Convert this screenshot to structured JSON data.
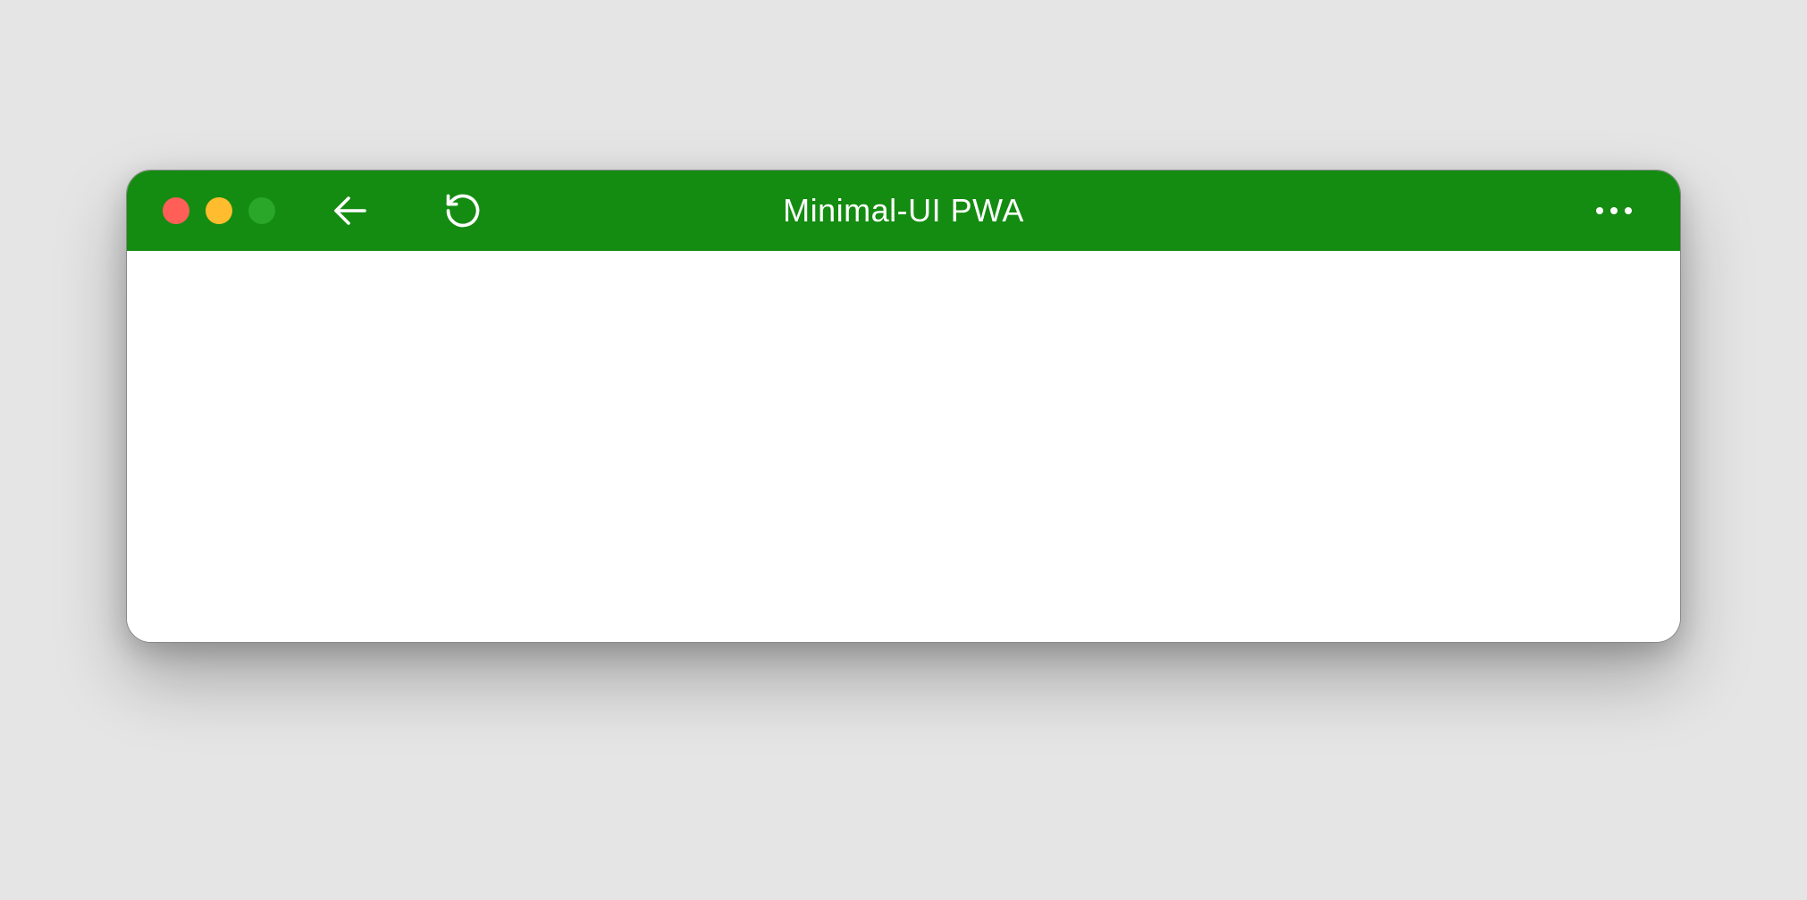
{
  "window": {
    "title": "Minimal-UI PWA"
  },
  "colors": {
    "titlebar_bg": "#148c11",
    "close": "#ff5f57",
    "minimize": "#febc2e",
    "maximize": "#2aa628",
    "background": "#e5e5e5",
    "content_bg": "#ffffff"
  },
  "icons": {
    "back": "back-arrow-icon",
    "reload": "reload-icon",
    "more": "more-menu-icon"
  }
}
